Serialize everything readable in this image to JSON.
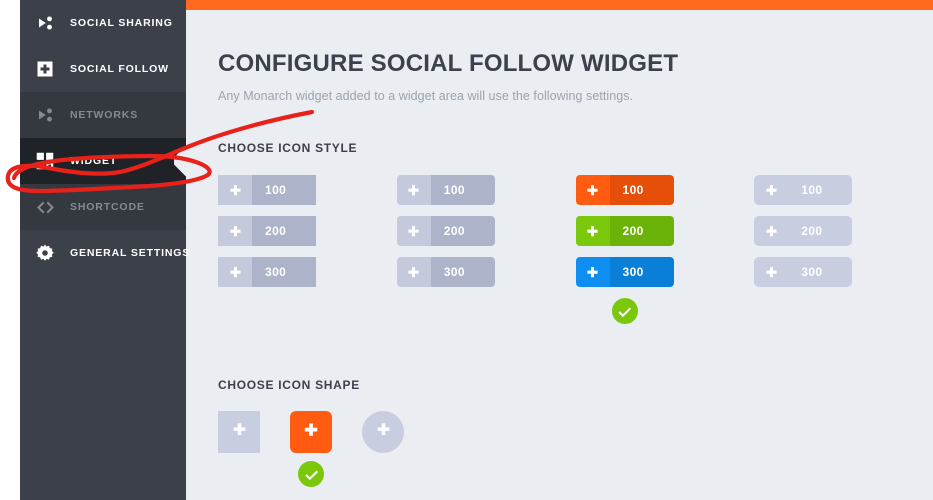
{
  "colors": {
    "accent_orange": "#ff6a1f",
    "sidebar_bg": "#3b4049",
    "sidebar_active_bg": "#1f2227",
    "sidebar_dim_bg": "#34383f",
    "panel_bg": "#eaeef2",
    "title_text": "#3b414d",
    "subtitle_text": "#9aa3ae",
    "muted_icon": "#c4c9dc",
    "muted_body": "#adb3c8",
    "flat_chip": "#c8cde0",
    "check_green": "#7ac70c",
    "style_100": "#ff5c11",
    "style_200": "#7ac70c",
    "style_300": "#0d8ef0",
    "shape_selected": "#ff5c11",
    "annotation_red": "#e8211a"
  },
  "sidebar": {
    "items": [
      {
        "label": "SOCIAL SHARING",
        "icon": "share-icon",
        "state": "normal",
        "name": "sidebar-item-social-sharing"
      },
      {
        "label": "SOCIAL FOLLOW",
        "icon": "plus-box-icon",
        "state": "normal",
        "name": "sidebar-item-social-follow"
      },
      {
        "label": "NETWORKS",
        "icon": "share-icon",
        "state": "dim",
        "name": "sidebar-item-networks"
      },
      {
        "label": "WIDGET",
        "icon": "grid-icon",
        "state": "active",
        "name": "sidebar-item-widget"
      },
      {
        "label": "SHORTCODE",
        "icon": "code-icon",
        "state": "dim",
        "name": "sidebar-item-shortcode"
      },
      {
        "label": "GENERAL SETTINGS",
        "icon": "gear-icon",
        "state": "normal",
        "name": "sidebar-item-general-settings"
      }
    ]
  },
  "header": {
    "title": "CONFIGURE SOCIAL FOLLOW WIDGET",
    "subtitle": "Any Monarch widget added to a widget area will use the following settings."
  },
  "icon_style": {
    "section_title": "CHOOSE ICON STYLE",
    "selected_index": 2,
    "options": [
      {
        "name": "icon-style-option-sharp",
        "variant": "sharp",
        "selected": false,
        "rows": [
          {
            "count": "100",
            "icon": "plus-icon"
          },
          {
            "count": "200",
            "icon": "plus-icon"
          },
          {
            "count": "300",
            "icon": "plus-icon"
          }
        ]
      },
      {
        "name": "icon-style-option-rounded",
        "variant": "rounded",
        "selected": false,
        "rows": [
          {
            "count": "100",
            "icon": "plus-icon"
          },
          {
            "count": "200",
            "icon": "plus-icon"
          },
          {
            "count": "300",
            "icon": "plus-icon"
          }
        ]
      },
      {
        "name": "icon-style-option-colored",
        "variant": "colored",
        "selected": true,
        "rows": [
          {
            "count": "100",
            "icon": "plus-icon",
            "color": "#ff5c11",
            "color_dark": "#e64f0a"
          },
          {
            "count": "200",
            "icon": "plus-icon",
            "color": "#7ac70c",
            "color_dark": "#6cb309"
          },
          {
            "count": "300",
            "icon": "plus-icon",
            "color": "#0d8ef0",
            "color_dark": "#0a7fd8"
          }
        ]
      },
      {
        "name": "icon-style-option-flat",
        "variant": "flat",
        "selected": false,
        "rows": [
          {
            "count": "100",
            "icon": "plus-icon"
          },
          {
            "count": "200",
            "icon": "plus-icon"
          },
          {
            "count": "300",
            "icon": "plus-icon"
          }
        ]
      }
    ]
  },
  "icon_shape": {
    "section_title": "CHOOSE ICON SHAPE",
    "selected_index": 1,
    "options": [
      {
        "name": "icon-shape-option-square",
        "shape": "square",
        "icon": "plus-icon",
        "selected": false
      },
      {
        "name": "icon-shape-option-rounded",
        "shape": "rounded",
        "icon": "plus-icon",
        "selected": true
      },
      {
        "name": "icon-shape-option-circle",
        "shape": "circle",
        "icon": "plus-icon",
        "selected": false
      }
    ]
  },
  "annotation": {
    "present": true,
    "kind": "hand-drawn-red-circle",
    "target": "sidebar-item-widget"
  }
}
